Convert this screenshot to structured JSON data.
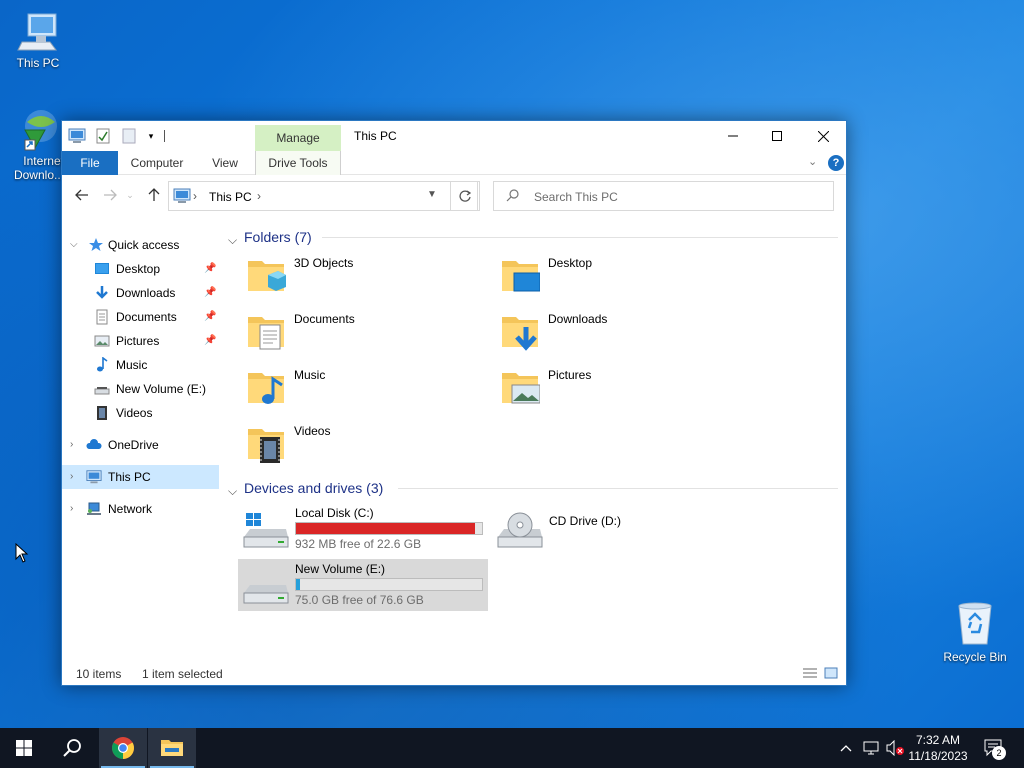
{
  "desktop": {
    "icons": [
      {
        "label": "This PC",
        "icon": "this-pc-icon"
      },
      {
        "label": "Internet Downlo...",
        "icon": "internet-download-manager-icon"
      },
      {
        "label": "Recycle Bin",
        "icon": "recycle-bin-icon"
      }
    ]
  },
  "window": {
    "title": "This PC",
    "context_tab": "Manage",
    "ribbon_tabs": [
      "File",
      "Computer",
      "View",
      "Drive Tools"
    ],
    "address": {
      "crumb": "This PC"
    },
    "search": {
      "placeholder": "Search This PC"
    }
  },
  "nav": {
    "quick_access": "Quick access",
    "quick_items": [
      {
        "label": "Desktop",
        "pinned": true
      },
      {
        "label": "Downloads",
        "pinned": true
      },
      {
        "label": "Documents",
        "pinned": true
      },
      {
        "label": "Pictures",
        "pinned": true
      },
      {
        "label": "Music",
        "pinned": false
      },
      {
        "label": "New Volume (E:)",
        "pinned": false
      },
      {
        "label": "Videos",
        "pinned": false
      }
    ],
    "onedrive": "OneDrive",
    "this_pc": "This PC",
    "network": "Network"
  },
  "content": {
    "folders_header": "Folders (7)",
    "folders": [
      "3D Objects",
      "Desktop",
      "Documents",
      "Downloads",
      "Music",
      "Pictures",
      "Videos"
    ],
    "drives_header": "Devices and drives (3)",
    "drives": [
      {
        "name": "Local Disk (C:)",
        "free": "932 MB free of 22.6 GB",
        "used_fraction": 0.96,
        "bar_color": "#da2626"
      },
      {
        "name": "CD Drive (D:)",
        "free": "",
        "used_fraction": null
      },
      {
        "name": "New Volume (E:)",
        "free": "75.0 GB free of 76.6 GB",
        "used_fraction": 0.02,
        "bar_color": "#26a0da"
      }
    ]
  },
  "status": {
    "items": "10 items",
    "selected": "1 item selected"
  },
  "taskbar": {
    "time": "7:32 AM",
    "date": "11/18/2023",
    "notifications": "2"
  },
  "colors": {
    "accent": "#1a6fc2",
    "selection": "#cce8ff",
    "manage_tab": "#d5f0c4"
  }
}
